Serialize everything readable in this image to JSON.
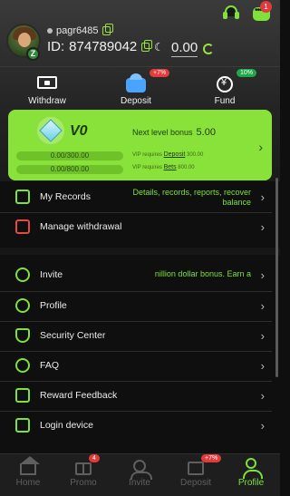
{
  "header": {
    "username": "pagr6485",
    "id_label": "ID:",
    "id_value": "874789042",
    "balance": "0.00",
    "chat_badge": "1"
  },
  "quick_actions": [
    {
      "label": "Withdraw",
      "icon": "wallet-icon",
      "badge": ""
    },
    {
      "label": "Deposit",
      "icon": "deposit-icon",
      "badge": "+7%"
    },
    {
      "label": "Fund",
      "icon": "fund-icon",
      "badge": "10%"
    }
  ],
  "vip": {
    "level": "V0",
    "next_label": "Next level bonus",
    "next_value": "5.00",
    "progress_deposit": "0.00/300.00",
    "progress_bets": "0.00/800.00",
    "req_prefix": "VIP requires",
    "req_deposit_link": "Deposit",
    "req_deposit_value": "300.00",
    "req_bets_link": "Bets",
    "req_bets_value": "800.00",
    "progress_deposit_fraction": 0,
    "progress_bets_fraction": 0
  },
  "menu_top": [
    {
      "label": "My Records",
      "right": "Details, records, reports, recover balance"
    },
    {
      "label": "Manage withdrawal",
      "right": ""
    }
  ],
  "menu_main": [
    {
      "label": "Invite",
      "right": "nillion dollar bonus. Earn a"
    },
    {
      "label": "Profile",
      "right": ""
    },
    {
      "label": "Security Center",
      "right": ""
    },
    {
      "label": "FAQ",
      "right": ""
    },
    {
      "label": "Reward Feedback",
      "right": ""
    },
    {
      "label": "Login device",
      "right": ""
    }
  ],
  "tabs": [
    {
      "label": "Home",
      "badge": ""
    },
    {
      "label": "Promo",
      "badge": "4"
    },
    {
      "label": "Invite",
      "badge": ""
    },
    {
      "label": "Deposit",
      "badge": "+7%"
    },
    {
      "label": "Profile",
      "badge": ""
    }
  ],
  "colors": {
    "accent": "#7fe13a",
    "vip_card": "#88e23a",
    "badge_red": "#e23a3a",
    "background": "#0f0f0f"
  }
}
